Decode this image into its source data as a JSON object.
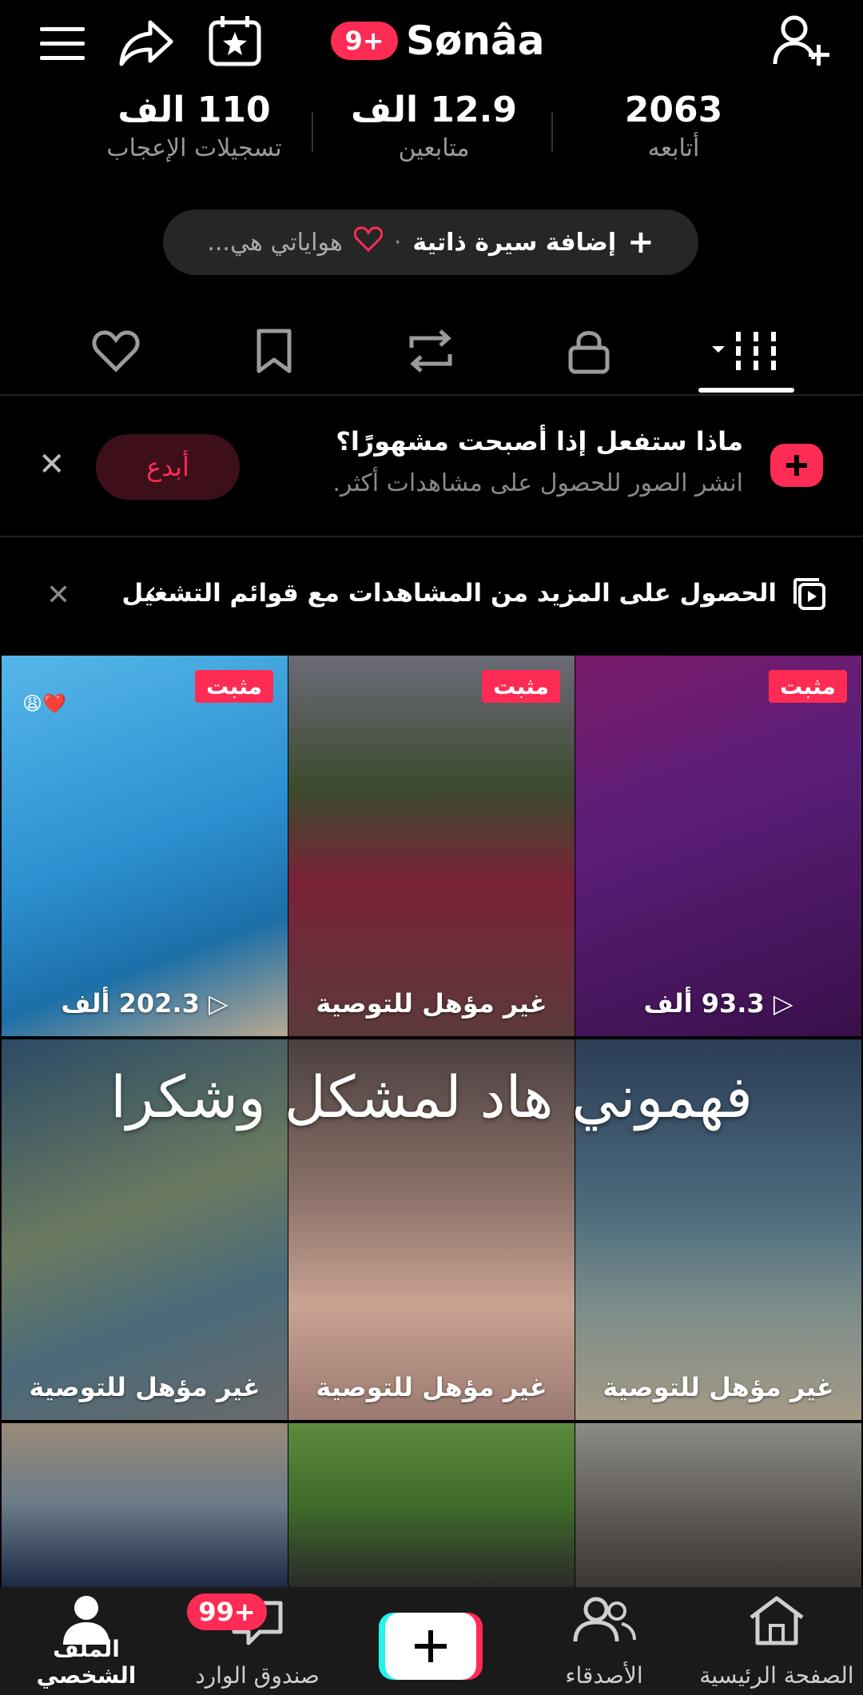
{
  "header": {
    "username": "Sønâa",
    "notif_badge": "9+"
  },
  "stats": [
    {
      "value": "2063",
      "label": "أتابعه"
    },
    {
      "value": "12.9 الف",
      "label": "متابعين"
    },
    {
      "value": "110 الف",
      "label": "تسجيلات الإعجاب"
    }
  ],
  "bio": {
    "add_label": "إضافة سيرة ذاتية",
    "hobbies_label": "هواياتي هي..."
  },
  "promo": {
    "title": "ماذا ستفعل إذا أصبحت مشهورًا؟",
    "subtitle": "انشر الصور للحصول على مشاهدات أكثر.",
    "button_label": "أبدع"
  },
  "playlist_banner": {
    "text": "الحصول على المزيد من المشاهدات مع قوائم التشغيل"
  },
  "grid": {
    "overlay_text": "فهموني هاد لمشكل وشكرا",
    "tiles": [
      {
        "pinned": "مثبت",
        "caption": "93.3 ألف"
      },
      {
        "pinned": "مثبت",
        "caption": "غير مؤهل للتوصية"
      },
      {
        "pinned": "مثبت",
        "caption": "202.3 ألف",
        "emoji": "😩❤️"
      },
      {
        "caption": "غير مؤهل للتوصية"
      },
      {
        "caption": "غير مؤهل للتوصية"
      },
      {
        "caption": "غير مؤهل للتوصية"
      }
    ]
  },
  "bottom_nav": {
    "home": "الصفحة الرئيسية",
    "friends": "الأصدقاء",
    "inbox": "صندوق الوارد",
    "inbox_badge": "99+",
    "profile": "الملف الشخصي"
  },
  "colors": {
    "accent": "#fe2c55",
    "background": "#000000"
  }
}
